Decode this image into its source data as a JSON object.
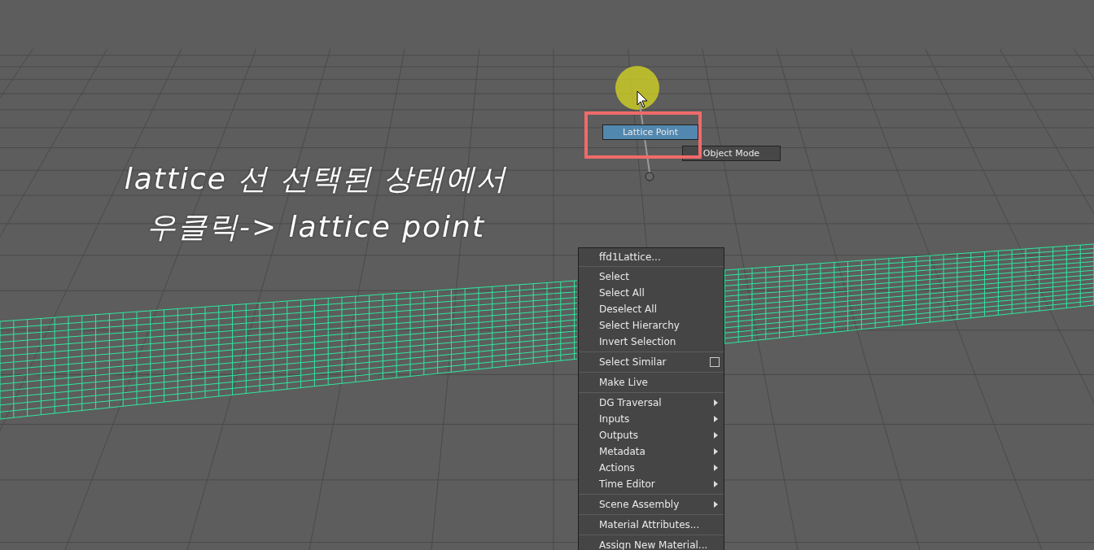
{
  "annotation": {
    "lines": [
      "lattice 선 선택된 상태에서",
      "우클릭-> lattice point"
    ]
  },
  "marking_menu": {
    "items": [
      {
        "label": "Lattice Point",
        "selected": true
      },
      {
        "label": "Object Mode",
        "selected": false
      }
    ]
  },
  "context_menu": {
    "title": "ffd1Lattice...",
    "sections": [
      [
        {
          "label": "Select",
          "kind": "plain"
        },
        {
          "label": "Select All",
          "kind": "plain"
        },
        {
          "label": "Deselect All",
          "kind": "plain"
        },
        {
          "label": "Select Hierarchy",
          "kind": "plain"
        },
        {
          "label": "Invert Selection",
          "kind": "plain"
        }
      ],
      [
        {
          "label": "Select Similar",
          "kind": "option"
        }
      ],
      [
        {
          "label": "Make Live",
          "kind": "plain"
        }
      ],
      [
        {
          "label": "DG Traversal",
          "kind": "submenu"
        },
        {
          "label": "Inputs",
          "kind": "submenu"
        },
        {
          "label": "Outputs",
          "kind": "submenu"
        },
        {
          "label": "Metadata",
          "kind": "submenu"
        },
        {
          "label": "Actions",
          "kind": "submenu"
        },
        {
          "label": "Time Editor",
          "kind": "submenu"
        }
      ],
      [
        {
          "label": "Scene Assembly",
          "kind": "submenu"
        }
      ],
      [
        {
          "label": "Material Attributes...",
          "kind": "plain"
        }
      ],
      [
        {
          "label": "Assign New Material...",
          "kind": "plain"
        }
      ]
    ]
  }
}
